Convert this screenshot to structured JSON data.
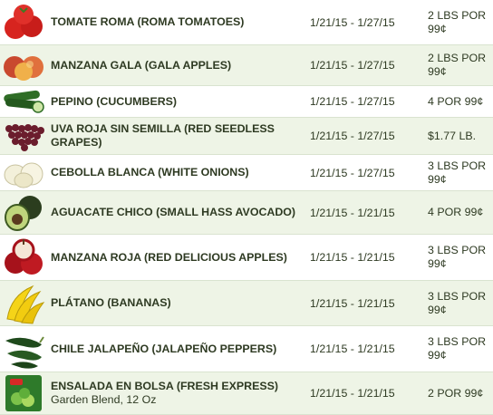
{
  "items": [
    {
      "name": "TOMATE ROMA (ROMA TOMATOES)",
      "sub": "",
      "dates": "1/21/15 - 1/27/15",
      "price": "2 LBS POR 99¢",
      "icon": "tomato-icon"
    },
    {
      "name": "MANZANA GALA (GALA APPLES)",
      "sub": "",
      "dates": "1/21/15 - 1/27/15",
      "price": "2 LBS POR 99¢",
      "icon": "gala-apple-icon"
    },
    {
      "name": "PEPINO (CUCUMBERS)",
      "sub": "",
      "dates": "1/21/15 - 1/27/15",
      "price": "4 POR 99¢",
      "icon": "cucumber-icon"
    },
    {
      "name": "UVA ROJA SIN SEMILLA (RED SEEDLESS GRAPES)",
      "sub": "",
      "dates": "1/21/15 - 1/27/15",
      "price": "$1.77 LB.",
      "icon": "grapes-icon"
    },
    {
      "name": "CEBOLLA BLANCA (WHITE ONIONS)",
      "sub": "",
      "dates": "1/21/15 - 1/27/15",
      "price": "3 LBS POR 99¢",
      "icon": "onion-icon"
    },
    {
      "name": "AGUACATE CHICO (SMALL HASS AVOCADO)",
      "sub": "",
      "dates": "1/21/15 - 1/21/15",
      "price": "4 POR 99¢",
      "icon": "avocado-icon"
    },
    {
      "name": "MANZANA ROJA (RED DELICIOUS APPLES)",
      "sub": "",
      "dates": "1/21/15 - 1/21/15",
      "price": "3 LBS POR 99¢",
      "icon": "red-apple-icon"
    },
    {
      "name": "PLÁTANO (BANANAS)",
      "sub": "",
      "dates": "1/21/15 - 1/21/15",
      "price": "3 LBS POR 99¢",
      "icon": "banana-icon"
    },
    {
      "name": "CHILE JALAPEÑO (JALAPEÑO PEPPERS)",
      "sub": "",
      "dates": "1/21/15 - 1/21/15",
      "price": "3 LBS POR 99¢",
      "icon": "jalapeno-icon"
    },
    {
      "name": "ENSALADA EN BOLSA (FRESH EXPRESS)",
      "sub": "Garden Blend, 12 Oz",
      "dates": "1/21/15 - 1/21/15",
      "price": "2 POR 99¢",
      "icon": "salad-bag-icon"
    }
  ],
  "colors": {
    "row_alt": "#eef4e6",
    "text": "#2e3a22",
    "divider": "#d9e3cf"
  }
}
